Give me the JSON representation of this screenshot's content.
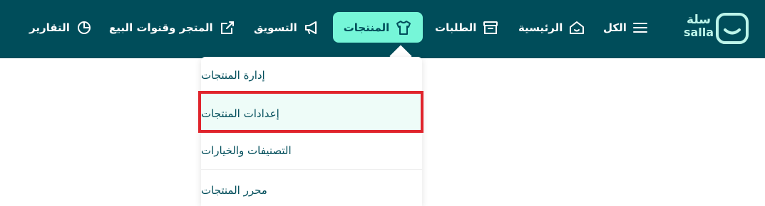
{
  "brand": {
    "name_ar": "سلة",
    "name_en": "salla"
  },
  "nav": [
    {
      "label": "الكل",
      "icon": "menu-icon"
    },
    {
      "label": "الرئيسية",
      "icon": "home-icon"
    },
    {
      "label": "الطلبات",
      "icon": "archive-box-icon"
    },
    {
      "label": "المنتجات",
      "icon": "tshirt-icon",
      "active": true
    },
    {
      "label": "التسويق",
      "icon": "megaphone-icon"
    },
    {
      "label": "المتجر وقنوات البيع",
      "icon": "store-channels-icon"
    },
    {
      "label": "التقارير",
      "icon": "pie-chart-icon"
    }
  ],
  "dropdown": {
    "items": [
      {
        "label": "إدارة المنتجات"
      },
      {
        "label": "إعدادات المنتجات",
        "selected": true
      },
      {
        "label": "التصنيفات والخيارات"
      },
      {
        "label": "محرر المنتجات"
      }
    ]
  },
  "colors": {
    "topbar": "#004d5a",
    "active_tab": "#76f6d8",
    "logo": "#bdf5ea",
    "highlight_border": "#e0242c",
    "selected_row": "#eefcf8"
  }
}
